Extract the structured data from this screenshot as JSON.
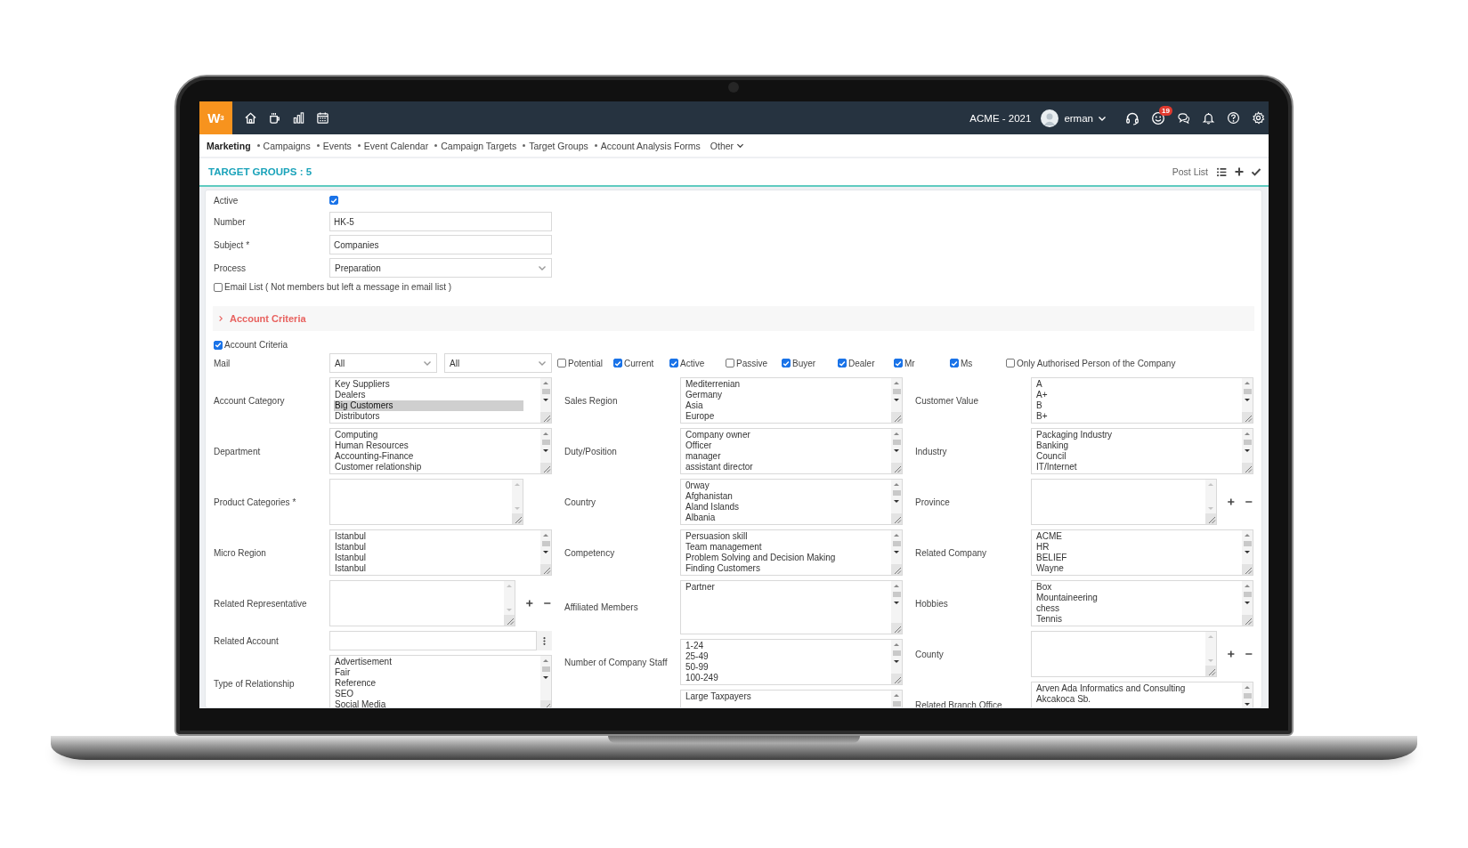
{
  "topbar": {
    "logo": "W$^{3}$",
    "company": "ACME - 2021",
    "user": "erman",
    "badge": "19"
  },
  "nav": [
    {
      "label": "Marketing",
      "selected": true
    },
    {
      "label": "Campaigns",
      "selected": false
    },
    {
      "label": "Events",
      "selected": false
    },
    {
      "label": "Event Calendar",
      "selected": false
    },
    {
      "label": "Campaign Targets",
      "selected": false
    },
    {
      "label": "Target Groups",
      "selected": false
    },
    {
      "label": "Account Analysis Forms",
      "selected": false
    }
  ],
  "nav_more": "Other",
  "page": {
    "title": "TARGET GROUPS : 5",
    "action": "Post List"
  },
  "form": {
    "active": {
      "label": "Active",
      "checked": true
    },
    "fields": [
      {
        "label": "Number",
        "kind": "text",
        "value": "HK-5"
      },
      {
        "label": "Subject *",
        "kind": "text",
        "value": "Companies"
      },
      {
        "label": "Process",
        "kind": "select",
        "value": "Preparation"
      }
    ],
    "email_list": {
      "label": "Email List ( Not members but left a message in email list )",
      "checked": false
    }
  },
  "section": {
    "title": "Account Criteria"
  },
  "criteria": {
    "toggle": {
      "label": "Account Criteria",
      "checked": true
    },
    "mail": {
      "label": "Mail",
      "values": [
        "All",
        "All"
      ]
    },
    "flags": [
      {
        "label": "Potential",
        "checked": false
      },
      {
        "label": "Current",
        "checked": true
      },
      {
        "label": "Active",
        "checked": true
      },
      {
        "label": "Passive",
        "checked": false
      },
      {
        "label": "Buyer",
        "checked": true
      },
      {
        "label": "Dealer",
        "checked": true
      },
      {
        "label": "Mr",
        "checked": true
      },
      {
        "label": "Ms",
        "checked": true
      },
      {
        "label": "Only Authorised Person of the Company",
        "checked": false
      }
    ],
    "columns": [
      [
        {
          "label": "Account Category",
          "kind": "list",
          "options": [
            {
              "text": "Key Suppliers",
              "selected": false
            },
            {
              "text": "Dealers",
              "selected": false
            },
            {
              "text": "Big Customers",
              "selected": true
            },
            {
              "text": "Distributors",
              "selected": false
            }
          ]
        },
        {
          "label": "Department",
          "kind": "list",
          "options": [
            {
              "text": "Computing",
              "selected": false
            },
            {
              "text": "Human Resources",
              "selected": false
            },
            {
              "text": "Accounting-Finance",
              "selected": false
            },
            {
              "text": "Customer relationship",
              "selected": false
            }
          ]
        },
        {
          "label": "Product Categories *",
          "kind": "list_narrow"
        },
        {
          "label": "Micro Region",
          "kind": "list",
          "options": [
            {
              "text": "Istanbul",
              "selected": false
            },
            {
              "text": "Istanbul",
              "selected": false
            },
            {
              "text": "Istanbul",
              "selected": false
            },
            {
              "text": "Istanbul",
              "selected": false
            }
          ]
        },
        {
          "label": "Related Representative",
          "kind": "list_add"
        },
        {
          "label": "Related Account",
          "kind": "lookup"
        },
        {
          "label": "Type of Relationship",
          "kind": "list",
          "options": [
            {
              "text": "Advertisement",
              "selected": false
            },
            {
              "text": "Fair",
              "selected": false
            },
            {
              "text": "Reference",
              "selected": false
            },
            {
              "text": "SEO",
              "selected": false
            },
            {
              "text": "Social Media",
              "selected": false
            }
          ]
        }
      ],
      [
        {
          "label": "Sales Region",
          "kind": "list",
          "options": [
            {
              "text": "Mediterrenian",
              "selected": false
            },
            {
              "text": "Germany",
              "selected": false
            },
            {
              "text": "Asia",
              "selected": false
            },
            {
              "text": "Europe",
              "selected": false
            }
          ]
        },
        {
          "label": "Duty/Position",
          "kind": "list",
          "options": [
            {
              "text": "Company owner",
              "selected": false
            },
            {
              "text": "Officer",
              "selected": false
            },
            {
              "text": "manager",
              "selected": false
            },
            {
              "text": "assistant director",
              "selected": false
            }
          ]
        },
        {
          "label": "Country",
          "kind": "list",
          "options": [
            {
              "text": "0rway",
              "selected": false
            },
            {
              "text": "Afghanistan",
              "selected": false
            },
            {
              "text": "Aland Islands",
              "selected": false
            },
            {
              "text": "Albania",
              "selected": false
            }
          ]
        },
        {
          "label": "Competency",
          "kind": "list",
          "options": [
            {
              "text": "Persuasion skill",
              "selected": false
            },
            {
              "text": "Team management",
              "selected": false
            },
            {
              "text": "Problem Solving and Decision Making",
              "selected": false
            },
            {
              "text": "Finding Customers",
              "selected": false
            }
          ]
        },
        {
          "label": "Affiliated Members",
          "kind": "tall_list",
          "options": [
            {
              "text": "Partner",
              "selected": false
            }
          ]
        },
        {
          "label": "Number of Company Staff",
          "kind": "list",
          "options": [
            {
              "text": "1-24",
              "selected": false
            },
            {
              "text": "25-49",
              "selected": false
            },
            {
              "text": "50-99",
              "selected": false
            },
            {
              "text": "100-249",
              "selected": false
            }
          ]
        },
        {
          "kind": "list",
          "options": [
            {
              "text": "Large Taxpayers",
              "selected": false
            }
          ]
        }
      ],
      [
        {
          "label": "Customer Value",
          "kind": "list",
          "options": [
            {
              "text": "A",
              "selected": false
            },
            {
              "text": "A+",
              "selected": false
            },
            {
              "text": "B",
              "selected": false
            },
            {
              "text": "B+",
              "selected": false
            }
          ]
        },
        {
          "label": "Industry",
          "kind": "list",
          "options": [
            {
              "text": "Packaging Industry",
              "selected": false
            },
            {
              "text": "Banking",
              "selected": false
            },
            {
              "text": "Council",
              "selected": false
            },
            {
              "text": "IT/Internet",
              "selected": false
            }
          ]
        },
        {
          "label": "Province",
          "kind": "list_add"
        },
        {
          "label": "Related Company",
          "kind": "list",
          "options": [
            {
              "text": "ACME",
              "selected": false
            },
            {
              "text": "HR",
              "selected": false
            },
            {
              "text": "BELIEF",
              "selected": false
            },
            {
              "text": "Wayne",
              "selected": false
            }
          ]
        },
        {
          "label": "Hobbies",
          "kind": "list",
          "options": [
            {
              "text": "Box",
              "selected": false
            },
            {
              "text": "Mountaineering",
              "selected": false
            },
            {
              "text": "chess",
              "selected": false
            },
            {
              "text": "Tennis",
              "selected": false
            }
          ]
        },
        {
          "label": "County",
          "kind": "list_add"
        },
        {
          "label": "Related Branch Office",
          "kind": "list",
          "options": [
            {
              "text": "Arven Ada Informatics and Consulting",
              "selected": false
            },
            {
              "text": "Akcakoca Sb.",
              "selected": false
            }
          ]
        }
      ]
    ]
  }
}
